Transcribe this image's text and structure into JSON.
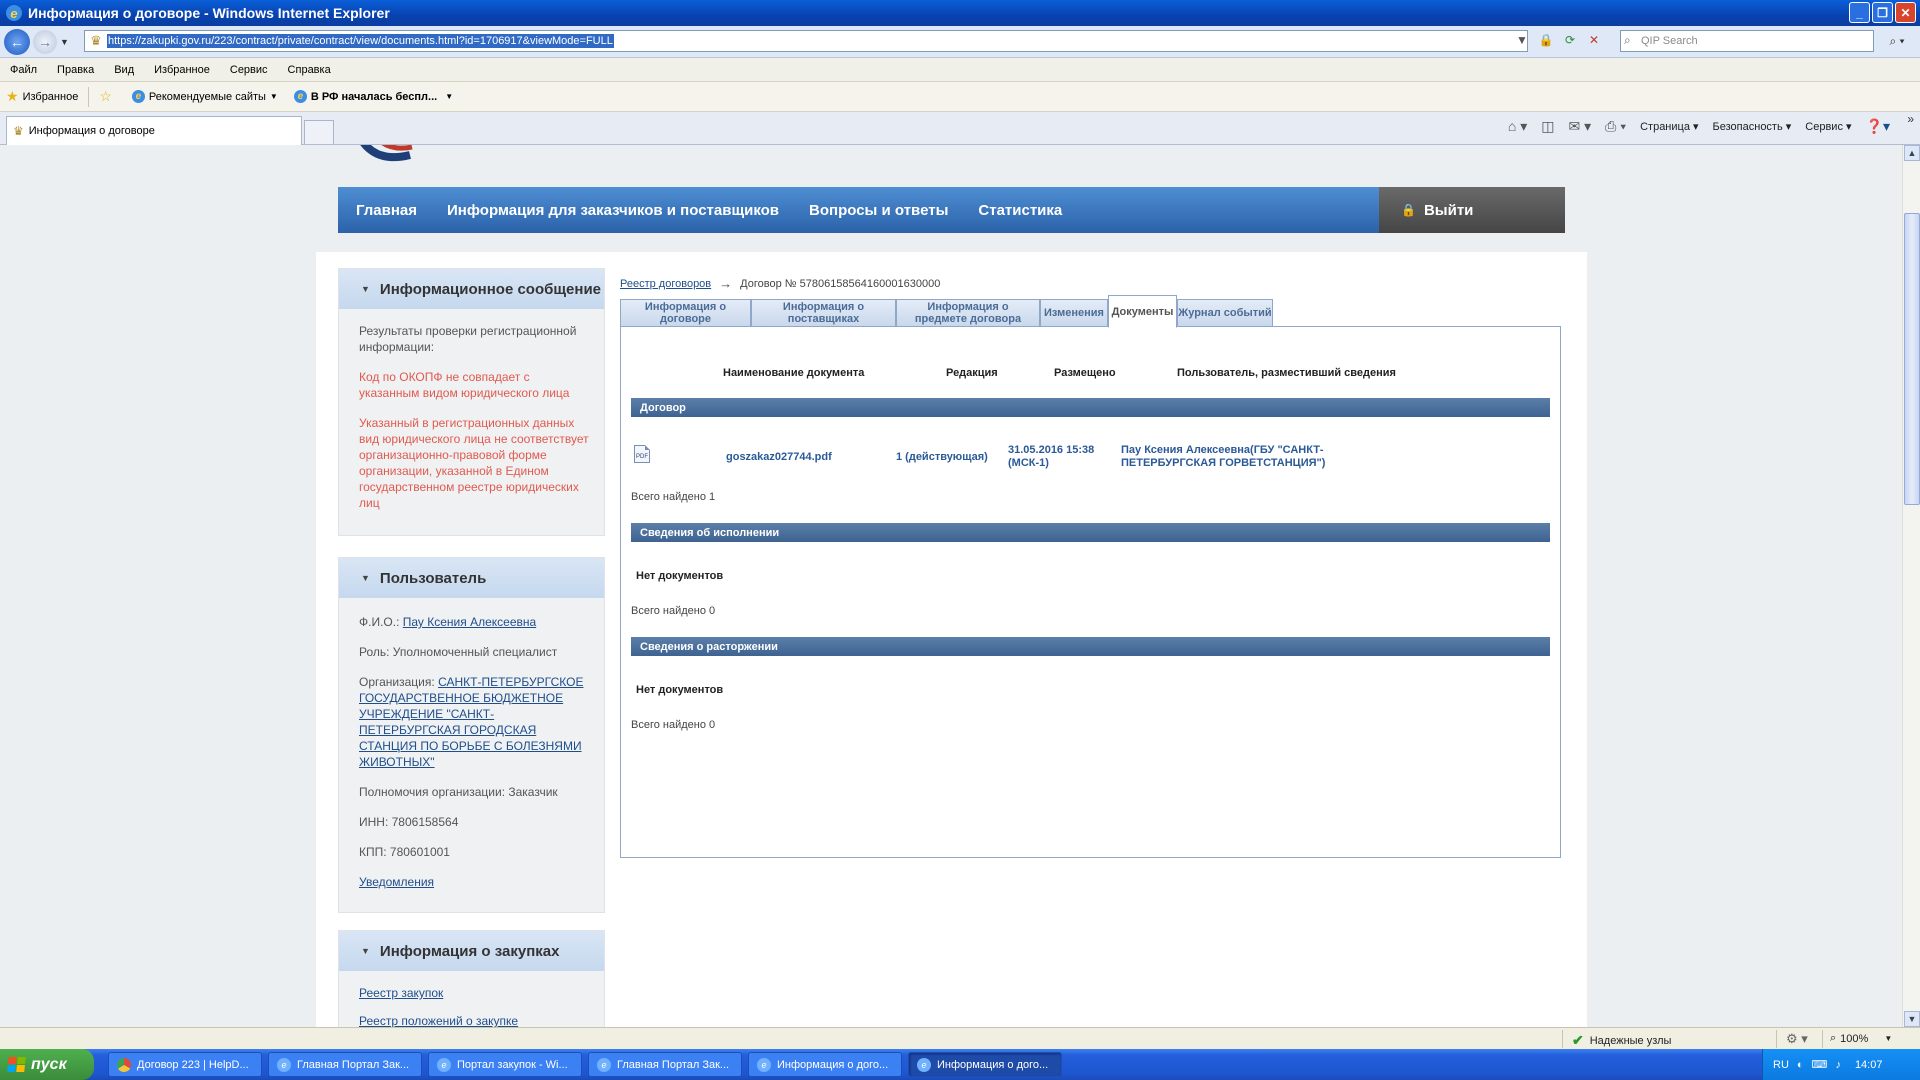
{
  "window": {
    "title": "Информация о договоре - Windows Internet Explorer",
    "minimize": "_",
    "restore": "❐",
    "close": "✕"
  },
  "address": {
    "url": "https://zakupki.gov.ru/223/contract/private/contract/view/documents.html?id=1706917&viewMode=FULL",
    "search_placeholder": "QIP Search"
  },
  "menu": [
    "Файл",
    "Правка",
    "Вид",
    "Избранное",
    "Сервис",
    "Справка"
  ],
  "favorites": {
    "favorites_label": "Избранное",
    "recommended_label": "Рекомендуемые сайты",
    "news_label": "В РФ началась беспл..."
  },
  "browser_tab": {
    "label": "Информация о договоре"
  },
  "command_bar": {
    "page": "Страница",
    "security": "Безопасность",
    "service": "Сервис"
  },
  "site_nav": {
    "items": [
      "Главная",
      "Информация для заказчиков и поставщиков",
      "Вопросы и ответы",
      "Статистика"
    ],
    "logout": "Выйти"
  },
  "info_panel": {
    "title": "Информационное сообщение",
    "intro": "Результаты проверки регистрационной информации:",
    "error1": "Код по ОКОПФ не совпадает с указанным видом юридического лица",
    "error2": "Указанный в регистрационных данных вид юридического лица не соответствует организационно-правовой форме организации, указанной в Едином государственном реестре юридических лиц"
  },
  "user_panel": {
    "title": "Пользователь",
    "fio_label": "Ф.И.О.:",
    "fio_value": "Пау Ксения Алексеевна",
    "role": "Роль: Уполномоченный специалист",
    "org_label": "Организация:",
    "org_value": "САНКТ-ПЕТЕРБУРГСКОЕ ГОСУДАРСТВЕННОЕ БЮДЖЕТНОЕ УЧРЕЖДЕНИЕ \"САНКТ-ПЕТЕРБУРГСКАЯ ГОРОДСКАЯ СТАНЦИЯ ПО БОРЬБЕ С БОЛЕЗНЯМИ ЖИВОТНЫХ\"",
    "authority": "Полномочия организации: Заказчик",
    "inn": "ИНН: 7806158564",
    "kpp": "КПП: 780601001",
    "notifications": "Уведомления"
  },
  "purchase_panel": {
    "title": "Информация о закупках",
    "link1": "Реестр закупок",
    "link2": "Реестр положений о закупке"
  },
  "breadcrumb": {
    "link": "Реестр договоров",
    "arrow": "→",
    "current": "Договор № 57806158564160001630000"
  },
  "content_tabs": [
    "Информация о договоре",
    "Информация о поставщиках",
    "Информация о предмете договора",
    "Изменения",
    "Документы",
    "Журнал событий"
  ],
  "table_headers": {
    "name": "Наименование документа",
    "edition": "Редакция",
    "posted": "Размещено",
    "user": "Пользователь, разместивший сведения"
  },
  "sections": {
    "contract": {
      "title": "Договор",
      "document": {
        "icon": "pdf",
        "file": "goszakaz027744.pdf",
        "edition": "1 (действующая)",
        "posted": "31.05.2016 15:38 (МСК-1)",
        "user": "Пау Ксения Алексеевна(ГБУ \"САНКТ-ПЕТЕРБУРГСКАЯ ГОРВЕТСТАНЦИЯ\")"
      },
      "total": "Всего найдено 1"
    },
    "execution": {
      "title": "Сведения об исполнении",
      "empty": "Нет документов",
      "total": "Всего найдено 0"
    },
    "termination": {
      "title": "Сведения о расторжении",
      "empty": "Нет документов",
      "total": "Всего найдено 0"
    }
  },
  "status_bar": {
    "zone": "Надежные узлы",
    "zoom": "100%"
  },
  "taskbar": {
    "start": "пуск",
    "tasks": [
      "Договор 223 | HelpD...",
      "Главная Портал Зак...",
      "Портал закупок - Wi...",
      "Главная Портал Зак...",
      "Информация о дого...",
      "Информация о дого..."
    ],
    "lang": "RU",
    "time": "14:07"
  }
}
